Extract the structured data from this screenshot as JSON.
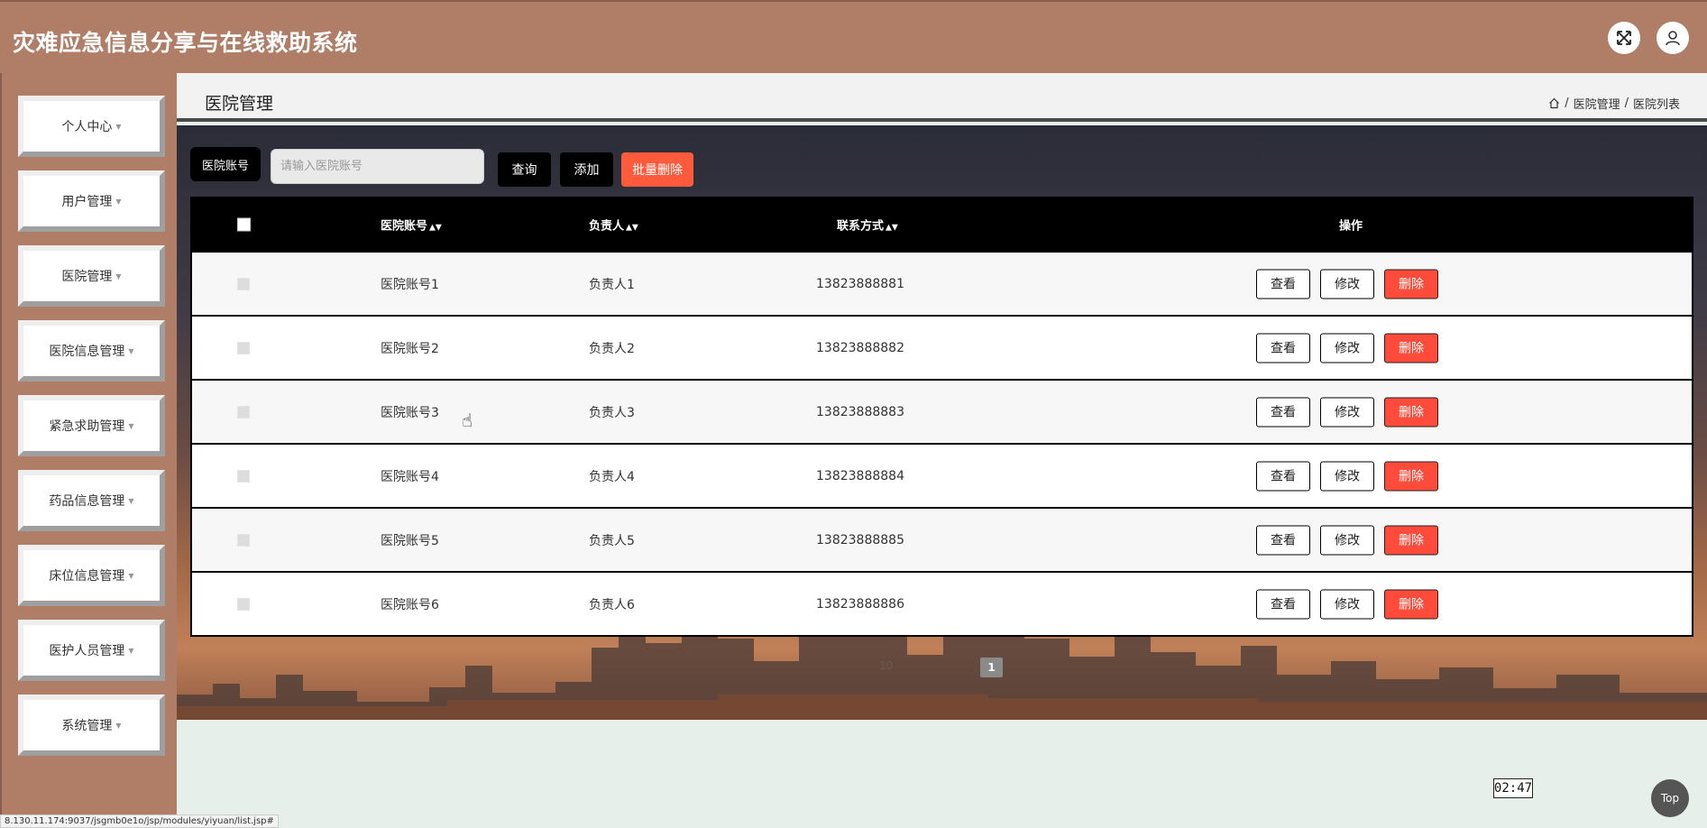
{
  "header": {
    "title": "灾难应急信息分享与在线救助系统",
    "expand_icon": "expand-icon",
    "user_icon": "user-icon"
  },
  "sidebar": {
    "items": [
      {
        "label": "个人中心"
      },
      {
        "label": "用户管理"
      },
      {
        "label": "医院管理"
      },
      {
        "label": "医院信息管理"
      },
      {
        "label": "紧急求助管理"
      },
      {
        "label": "药品信息管理"
      },
      {
        "label": "床位信息管理"
      },
      {
        "label": "医护人员管理"
      },
      {
        "label": "系统管理"
      }
    ]
  },
  "page": {
    "title": "医院管理",
    "breadcrumb": [
      "医院管理",
      "医院列表"
    ]
  },
  "search": {
    "label": "医院账号",
    "placeholder": "请输入医院账号",
    "value": "",
    "query_label": "查询",
    "add_label": "添加",
    "batch_delete_label": "批量删除"
  },
  "table": {
    "columns": [
      "医院账号",
      "负责人",
      "联系方式",
      "操作"
    ],
    "rows": [
      {
        "account": "医院账号1",
        "owner": "负责人1",
        "phone": "13823888881"
      },
      {
        "account": "医院账号2",
        "owner": "负责人2",
        "phone": "13823888882"
      },
      {
        "account": "医院账号3",
        "owner": "负责人3",
        "phone": "13823888883"
      },
      {
        "account": "医院账号4",
        "owner": "负责人4",
        "phone": "13823888884"
      },
      {
        "account": "医院账号5",
        "owner": "负责人5",
        "phone": "13823888885"
      },
      {
        "account": "医院账号6",
        "owner": "负责人6",
        "phone": "13823888886"
      }
    ],
    "actions": {
      "view": "查看",
      "edit": "修改",
      "delete": "删除"
    }
  },
  "pagination": {
    "page_size": "10",
    "current_page": "1"
  },
  "misc": {
    "timer": "02:47",
    "top_label": "Top",
    "status_url": "8.130.11.174:9037/jsgmb0e1o/jsp/modules/yiyuan/list.jsp#"
  },
  "colors": {
    "header_bg": "#b07d67",
    "delete_red": "#ff4b3a",
    "batch_delete": "#ff5a3b"
  }
}
